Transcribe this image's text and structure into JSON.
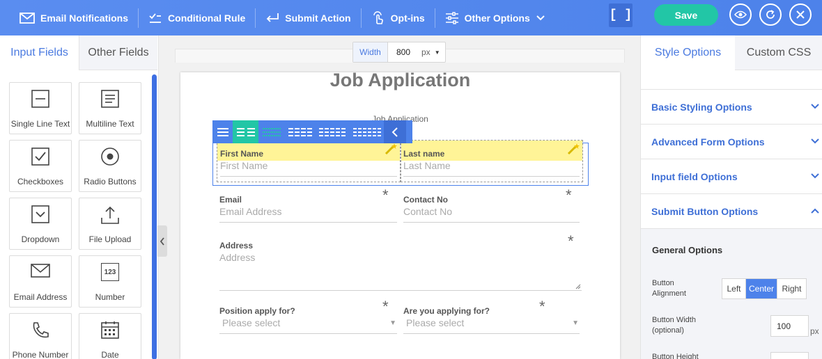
{
  "toolbar": {
    "email_notifications": "Email Notifications",
    "conditional_rule": "Conditional Rule",
    "submit_action": "Submit Action",
    "opt_ins": "Opt-ins",
    "other_options": "Other Options",
    "expand": "[ ]",
    "save": "Save"
  },
  "left_panel": {
    "tabs": [
      "Input Fields",
      "Other Fields"
    ],
    "fields": [
      {
        "label": "Single Line Text",
        "icon": "single-line-text-icon"
      },
      {
        "label": "Multiline Text",
        "icon": "multiline-text-icon"
      },
      {
        "label": "Checkboxes",
        "icon": "checkbox-icon"
      },
      {
        "label": "Radio Buttons",
        "icon": "radio-button-icon"
      },
      {
        "label": "Dropdown",
        "icon": "dropdown-icon"
      },
      {
        "label": "File Upload",
        "icon": "upload-icon"
      },
      {
        "label": "Email Address",
        "icon": "envelope-icon"
      },
      {
        "label": "Number",
        "icon": "number-icon"
      },
      {
        "label": "Phone Number",
        "icon": "phone-icon"
      },
      {
        "label": "Date",
        "icon": "calendar-icon"
      }
    ]
  },
  "canvas": {
    "width_label": "Width",
    "width_value": "800",
    "width_unit": "px",
    "title": "Job Application",
    "subtitle": "Job Application",
    "number_icon_text": "123",
    "fields": {
      "first_name": {
        "label": "First Name",
        "placeholder": "First Name"
      },
      "last_name": {
        "label": "Last name",
        "placeholder": "Last Name"
      },
      "email": {
        "label": "Email",
        "placeholder": "Email Address",
        "required": "*"
      },
      "contact": {
        "label": "Contact No",
        "placeholder": "Contact No",
        "required": "*"
      },
      "address": {
        "label": "Address",
        "placeholder": "Address",
        "required": "*"
      },
      "position": {
        "label": "Position apply for?",
        "placeholder": "Please select",
        "required": "*"
      },
      "applying": {
        "label": "Are you applying for?",
        "placeholder": "Please select",
        "required": "*"
      }
    }
  },
  "right_panel": {
    "tabs": [
      "Style Options",
      "Custom CSS"
    ],
    "sections": [
      "Basic Styling Options",
      "Advanced Form Options",
      "Input field Options",
      "Submit Button Options"
    ],
    "general_options": "General Options",
    "button_alignment": "Button Alignment",
    "alignments": [
      "Left",
      "Center",
      "Right"
    ],
    "selected_alignment": "Center",
    "button_width_label": "Button Width (optional)",
    "button_width_value": "100",
    "button_width_unit": "px",
    "button_height_label": "Button Height"
  },
  "colors": {
    "primary": "#4d82ea",
    "save": "#22c6a6",
    "highlight": "#fff497"
  }
}
